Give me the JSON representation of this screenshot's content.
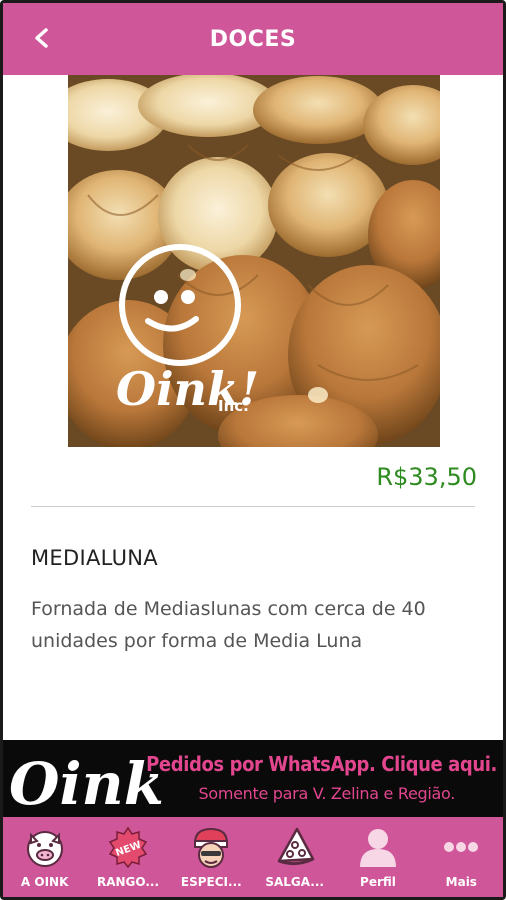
{
  "header": {
    "title": "DOCES",
    "back_icon": "chevron-left-icon"
  },
  "product": {
    "image_logo_text": "Oink!",
    "image_logo_sub": "Inc.",
    "price": "R$33,50",
    "name": "MEDIALUNA",
    "description": "Fornada de Mediaslunas com cerca de 40 unidades por forma de Media Luna"
  },
  "banner": {
    "logo_text": "Oink!",
    "line1": "Pedidos por WhatsApp. Clique aqui.",
    "line2": "Somente para V. Zelina e Região."
  },
  "tabs": [
    {
      "label": "A OINK",
      "icon": "pig-icon"
    },
    {
      "label": "RANGO...",
      "icon": "new-badge-icon"
    },
    {
      "label": "ESPECI...",
      "icon": "chef-icon"
    },
    {
      "label": "SALGA...",
      "icon": "pizza-slice-icon"
    },
    {
      "label": "Perfil",
      "icon": "user-icon"
    },
    {
      "label": "Mais",
      "icon": "more-dots-icon"
    }
  ],
  "colors": {
    "header": "#d0569a",
    "tabbar": "#d0569a",
    "price": "#2e8b1f",
    "banner_text": "#e2468f"
  }
}
